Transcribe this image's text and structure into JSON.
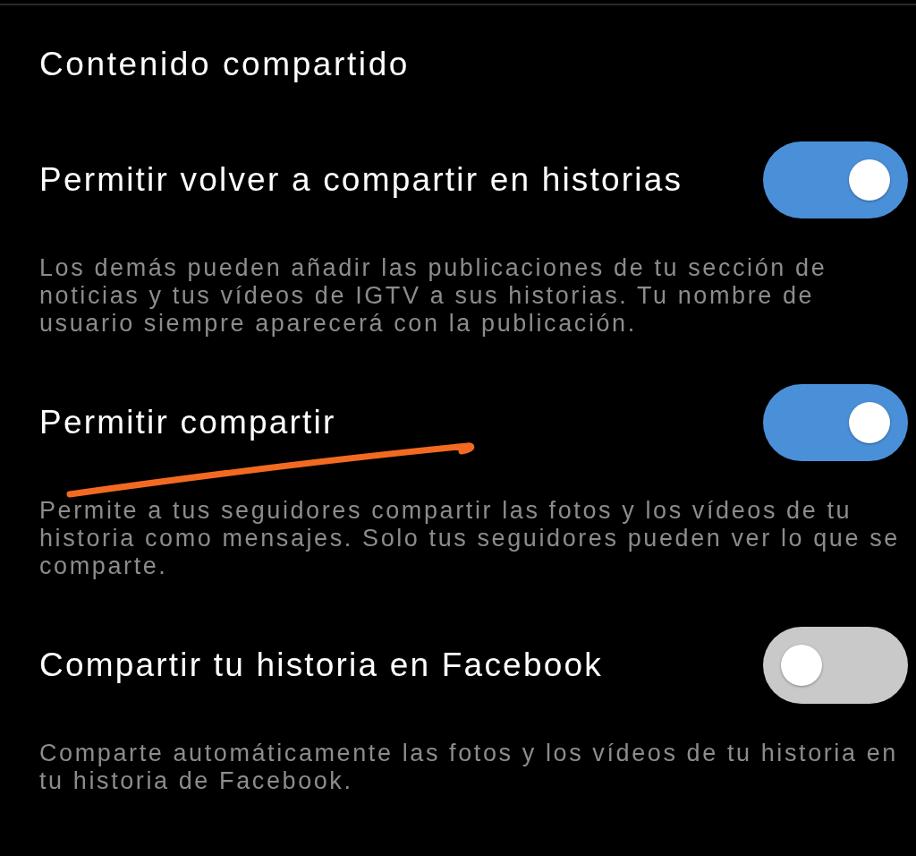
{
  "section_title": "Contenido compartido",
  "settings": [
    {
      "title": "Permitir volver a compartir en historias",
      "on": true,
      "description": "Los demás pueden añadir las publicaciones de tu sección de noticias y tus vídeos de IGTV a sus historias. Tu nombre de usuario siempre aparecerá con la publicación."
    },
    {
      "title": "Permitir compartir",
      "on": true,
      "description": "Permite a tus seguidores compartir las fotos y los vídeos de tu historia como mensajes. Solo tus seguidores pueden ver lo que se comparte."
    },
    {
      "title": "Compartir tu historia en Facebook",
      "on": false,
      "description": "Comparte automáticamente las fotos y los vídeos de tu historia en tu historia de Facebook."
    }
  ]
}
